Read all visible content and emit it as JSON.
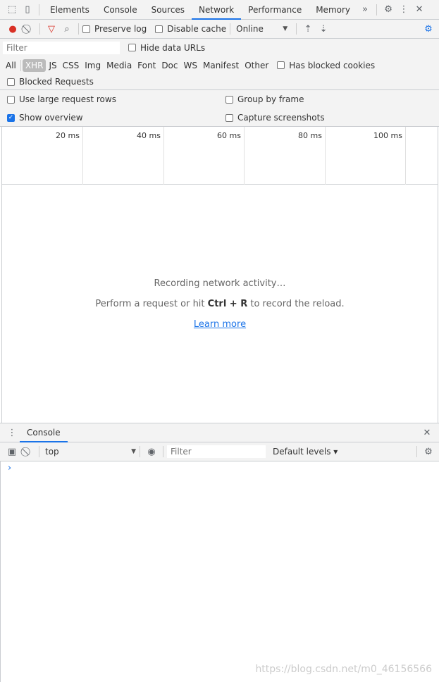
{
  "main_tabs": [
    "Elements",
    "Console",
    "Sources",
    "Network",
    "Performance",
    "Memory"
  ],
  "toolbar": {
    "preserve_log": "Preserve log",
    "disable_cache": "Disable cache",
    "throttling": "Online"
  },
  "filter": {
    "placeholder": "Filter",
    "hide_data_urls": "Hide data URLs"
  },
  "types": [
    "All",
    "XHR",
    "JS",
    "CSS",
    "Img",
    "Media",
    "Font",
    "Doc",
    "WS",
    "Manifest",
    "Other"
  ],
  "has_blocked_cookies": "Has blocked cookies",
  "blocked_requests": "Blocked Requests",
  "settings": {
    "large_rows": "Use large request rows",
    "group_by_frame": "Group by frame",
    "show_overview": "Show overview",
    "capture_screenshots": "Capture screenshots"
  },
  "timeline_ticks": [
    "20 ms",
    "40 ms",
    "60 ms",
    "80 ms",
    "100 ms"
  ],
  "empty_state": {
    "line1": "Recording network activity…",
    "line2_pre": "Perform a request or hit ",
    "line2_keys": "Ctrl + R",
    "line2_post": " to record the reload.",
    "learn_more": "Learn more"
  },
  "drawer": {
    "tab": "Console",
    "context": "top",
    "filter_placeholder": "Filter",
    "levels": "Default levels ▾"
  },
  "watermark": "https://blog.csdn.net/m0_46156566"
}
